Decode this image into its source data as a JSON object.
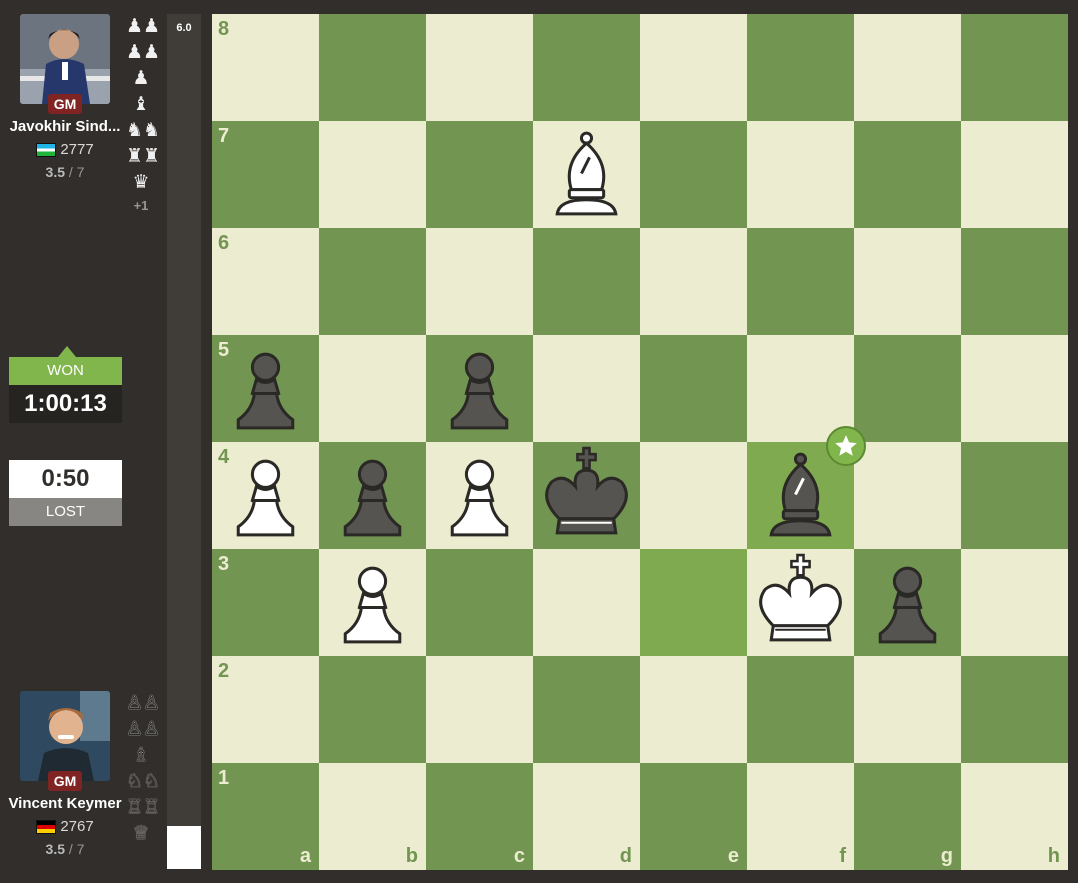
{
  "top_player": {
    "title": "GM",
    "name": "Javokhir Sind...",
    "rating": "2777",
    "flag": "UZ",
    "score": "3.5",
    "score_total": " / 7",
    "captured": [
      "pawn",
      "pawn",
      "pawn",
      "bishop",
      "knight",
      "rook",
      "queen"
    ],
    "captured_color": "black",
    "advantage": "+1"
  },
  "bottom_player": {
    "title": "GM",
    "name": "Vincent Keymer",
    "rating": "2767",
    "flag": "DE",
    "score": "3.5",
    "score_total": " / 7",
    "captured": [
      "pawn",
      "pawn",
      "bishop",
      "knight",
      "rook",
      "queen"
    ],
    "captured_color": "white"
  },
  "clocks": {
    "top_result": "WON",
    "top_time": "1:00:13",
    "bottom_time": "0:50",
    "bottom_result": "LOST"
  },
  "eval": {
    "value": "6.0"
  },
  "board": {
    "ranks": [
      "8",
      "7",
      "6",
      "5",
      "4",
      "3",
      "2",
      "1"
    ],
    "files": [
      "a",
      "b",
      "c",
      "d",
      "e",
      "f",
      "g",
      "h"
    ],
    "pieces": {
      "d7": "wB",
      "a5": "bP",
      "c5": "bP",
      "a4": "wP",
      "b4": "bP",
      "c4": "wP",
      "d4": "bK",
      "f4": "bB",
      "b3": "wP",
      "f3": "wK",
      "g3": "bP"
    },
    "highlighted_squares": [
      "e3",
      "f4"
    ],
    "starred_square": "f4"
  },
  "colors": {
    "light_square": "#ebecd0",
    "dark_square": "#739552",
    "win_green": "#81b64c",
    "gm_badge": "#7f2323"
  }
}
